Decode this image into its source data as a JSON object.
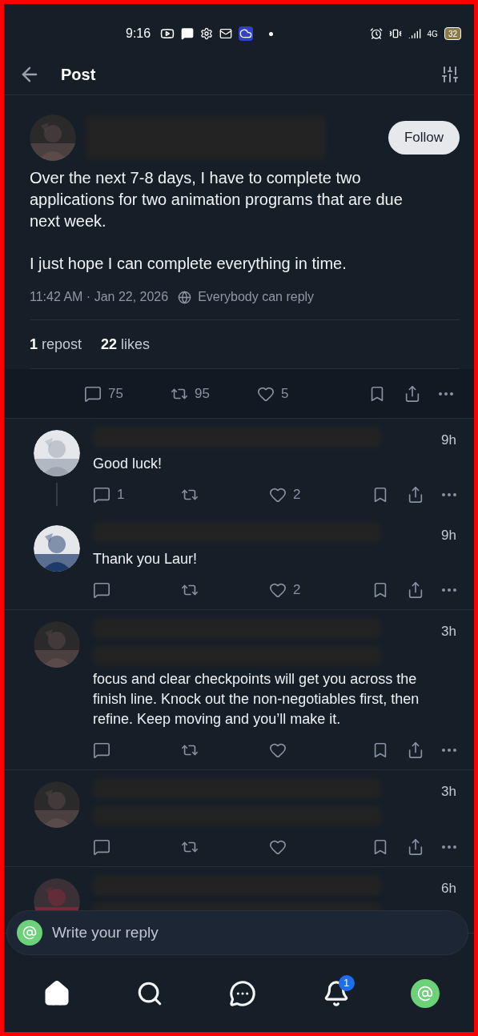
{
  "status_bar": {
    "time": "9:16",
    "network": "4G",
    "battery": "32"
  },
  "header": {
    "title": "Post"
  },
  "post": {
    "follow_label": "Follow",
    "redacted_author": true,
    "paragraphs": [
      "Over the next 7-8 days, I have to complete two applications for two animation programs that are due next week.",
      "I just hope I can complete everything in time."
    ],
    "timestamp": "11:42 AM · Jan 22, 2026",
    "reply_setting": "Everybody can reply",
    "stats": [
      {
        "count": "1",
        "label": "repost"
      },
      {
        "count": "22",
        "label": "likes"
      }
    ],
    "actions": {
      "replies": "75",
      "reposts": "95",
      "likes": "5"
    }
  },
  "replies": [
    {
      "time": "9h",
      "body": "Good luck!",
      "redacted_body": false,
      "thread_line": true,
      "replies": "1",
      "likes": "2"
    },
    {
      "time": "9h",
      "body": "Thank you Laur!",
      "redacted_body": false,
      "thread_line": false,
      "likes": "2"
    },
    {
      "time": "3h",
      "body": "focus and clear checkpoints will get you across the finish line. Knock out the non-negotiables first, then refine. Keep moving and you’ll make it.",
      "redacted_body": true,
      "thread_line": false
    },
    {
      "time": "3h",
      "redacted_body": true,
      "thread_line": false
    },
    {
      "time": "6h",
      "redacted_body": true,
      "thread_line": false,
      "actions_visible": false
    }
  ],
  "composer": {
    "placeholder": "Write your reply"
  },
  "nav": [
    {
      "kind": "home",
      "selected": true
    },
    {
      "kind": "search",
      "selected": false
    },
    {
      "kind": "chat",
      "selected": false
    },
    {
      "kind": "bell",
      "selected": false,
      "badge": "1"
    },
    {
      "kind": "profile",
      "selected": false
    }
  ]
}
